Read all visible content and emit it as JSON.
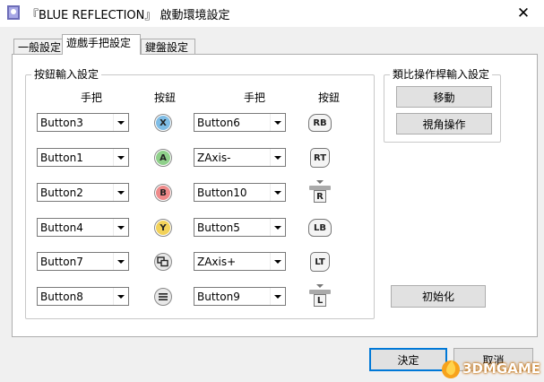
{
  "window": {
    "title": "『BLUE REFLECTION』 啟動環境設定",
    "close_glyph": "✕"
  },
  "tabs": [
    {
      "label": "一般設定",
      "active": false
    },
    {
      "label": "遊戲手把設定",
      "active": true
    },
    {
      "label": "鍵盤設定",
      "active": false
    }
  ],
  "button_group": {
    "title": "按鈕輸入設定",
    "col_gamepad": "手把",
    "col_button": "按鈕",
    "left_rows": [
      {
        "value": "Button3",
        "icon": "x-button-icon",
        "glyph": "X",
        "color": "#7fbde6"
      },
      {
        "value": "Button1",
        "icon": "a-button-icon",
        "glyph": "A",
        "color": "#8fd08a"
      },
      {
        "value": "Button2",
        "icon": "b-button-icon",
        "glyph": "B",
        "color": "#ee8a8a"
      },
      {
        "value": "Button4",
        "icon": "y-button-icon",
        "glyph": "Y",
        "color": "#f2d25a"
      },
      {
        "value": "Button7",
        "icon": "view-button-icon",
        "glyph": "⧉",
        "color": "#e8e8e8"
      },
      {
        "value": "Button8",
        "icon": "menu-button-icon",
        "glyph": "≡",
        "color": "#e8e8e8"
      }
    ],
    "right_rows": [
      {
        "value": "Button6",
        "icon": "rb-bumper-icon",
        "glyph": "RB"
      },
      {
        "value": "ZAxis-",
        "icon": "rt-trigger-icon",
        "glyph": "RT"
      },
      {
        "value": "Button10",
        "icon": "right-stick-press-icon",
        "glyph": "R"
      },
      {
        "value": "Button5",
        "icon": "lb-bumper-icon",
        "glyph": "LB"
      },
      {
        "value": "ZAxis+",
        "icon": "lt-trigger-icon",
        "glyph": "LT"
      },
      {
        "value": "Button9",
        "icon": "left-stick-press-icon",
        "glyph": "L"
      }
    ]
  },
  "analog_group": {
    "title": "類比操作桿輸入設定",
    "move_label": "移動",
    "camera_label": "視角操作"
  },
  "reset_label": "初始化",
  "footer": {
    "ok_label": "決定",
    "cancel_label": "取消"
  },
  "watermark": "3DMGAME"
}
